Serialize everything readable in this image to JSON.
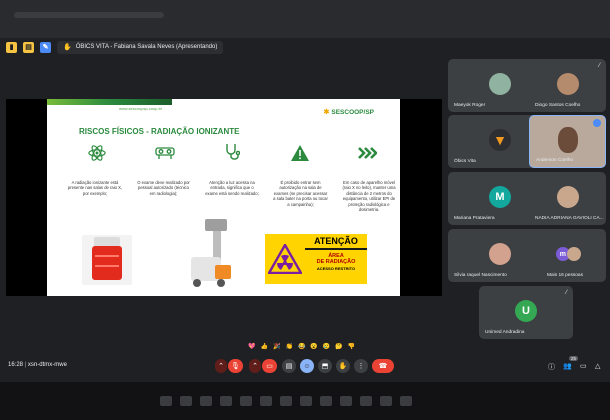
{
  "presenter_tag": "ÓBICS VITA - Fabiana Savala Neves (Apresentando)",
  "slide": {
    "url": "www.sescoopsp.coop.br",
    "logo": "SESCOOP/SP",
    "title": "RISCOS FÍSICOS - RADIAÇÃO IONIZANTE",
    "columns": [
      "A radiação ionizante está presente nas salas de raio X, por exemplo;",
      "O exame deve realizado por pessoal autorizado (técnico em radiologia);",
      "Atenção a luz acessa na entrada, significa que o exame está sendo realizado;",
      "É proibido entrar sem autorização na sala de exames (se precisar acessar a sala bater na porta ou tocar a campainha);",
      "Em caso de aparelho móvel (raio X no leito), manter uma distância de 2 metros do equipamento, utilizar EPI de proteção radiológica e dosimetria."
    ],
    "sign": {
      "heading": "ATENÇÃO",
      "line1": "ÁREA",
      "line2": "DE RADIAÇÃO",
      "line3": "ACESSO RESTRITO"
    }
  },
  "participants": [
    {
      "name": "Maeyok Roger",
      "avatar_color": "#8fb3a0"
    },
    {
      "name": "Diogo Santos Coelho",
      "avatar_color": "#b58b6e"
    },
    {
      "name": "Óbics Vita",
      "avatar_color": "#f29a1f"
    },
    {
      "name": "Anderson Coelho",
      "avatar_color": "#c7a58a"
    },
    {
      "name": "Mariana Prataviera",
      "avatar_color": "#12a89d",
      "initial": "M"
    },
    {
      "name": "NADIA ADRIANA GAVIOLI CA...",
      "avatar_color": "#c9a78c"
    },
    {
      "name": "Silvia raquel Nascimento",
      "avatar_color": "#d3a28e"
    },
    {
      "name": "Mais 16 pessoas",
      "avatar_color": "#7b5cd6",
      "initial": "m"
    },
    {
      "name": "Unimed Andradina",
      "avatar_color": "#34a853",
      "initial": "U"
    }
  ],
  "meeting": {
    "time": "16:28",
    "code": "xsn-dtmx-mwe",
    "participant_count": "25"
  },
  "colors": {
    "end_call": "#ea4335",
    "mic_off": "#ea4335",
    "active": "#8ab4f8",
    "brand_green": "#2b8a3e"
  }
}
